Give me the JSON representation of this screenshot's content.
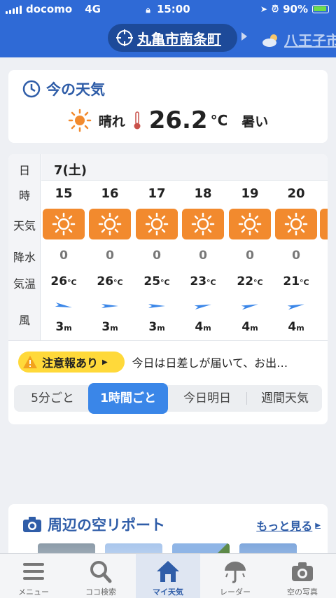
{
  "status_bar": {
    "carrier": "docomo",
    "network": "4G",
    "time": "15:00",
    "battery": "90%"
  },
  "header": {
    "current_location": "丸亀市南条町",
    "next_location": "八王子市"
  },
  "now": {
    "title": "今の天気",
    "weather": "晴れ",
    "temperature": "26.2",
    "unit": "°C",
    "feel": "暑い"
  },
  "forecast": {
    "labels": {
      "day": "日",
      "hour": "時",
      "weather": "天気",
      "rain": "降水",
      "temp": "気温",
      "wind": "風"
    },
    "date": "7(土)",
    "hours": [
      {
        "hour": "15",
        "weather_icon": "sun-icon",
        "rain": "0",
        "temp": "26",
        "wind_speed": "3"
      },
      {
        "hour": "16",
        "weather_icon": "sun-icon",
        "rain": "0",
        "temp": "26",
        "wind_speed": "3"
      },
      {
        "hour": "17",
        "weather_icon": "sun-icon",
        "rain": "0",
        "temp": "25",
        "wind_speed": "3"
      },
      {
        "hour": "18",
        "weather_icon": "sun-icon",
        "rain": "0",
        "temp": "23",
        "wind_speed": "4"
      },
      {
        "hour": "19",
        "weather_icon": "sun-icon",
        "rain": "0",
        "temp": "22",
        "wind_speed": "4"
      },
      {
        "hour": "20",
        "weather_icon": "sun-icon",
        "rain": "0",
        "temp": "21",
        "wind_speed": "4"
      }
    ],
    "temp_unit": "°C",
    "wind_unit": "m"
  },
  "alert": {
    "badge": "注意報あり",
    "text": "今日は日差しが届いて、お出…"
  },
  "tabs": [
    "5分ごと",
    "1時間ごと",
    "今日明日",
    "週間天気"
  ],
  "active_tab": "1時間ごと",
  "report": {
    "title": "周辺の空リポート",
    "more": "もっと見る"
  },
  "nav": [
    {
      "label": "メニュー",
      "icon": "menu-icon"
    },
    {
      "label": "ココ検索",
      "icon": "search-icon"
    },
    {
      "label": "マイ天気",
      "icon": "home-icon"
    },
    {
      "label": "レーダー",
      "icon": "radar-umbrella-icon"
    },
    {
      "label": "空の写真",
      "icon": "camera-icon"
    }
  ],
  "colors": {
    "brand_blue": "#2f6ad6",
    "sun_orange": "#f28a2e",
    "alert_yellow": "#ffd93a",
    "active_tab": "#3a86e8"
  }
}
